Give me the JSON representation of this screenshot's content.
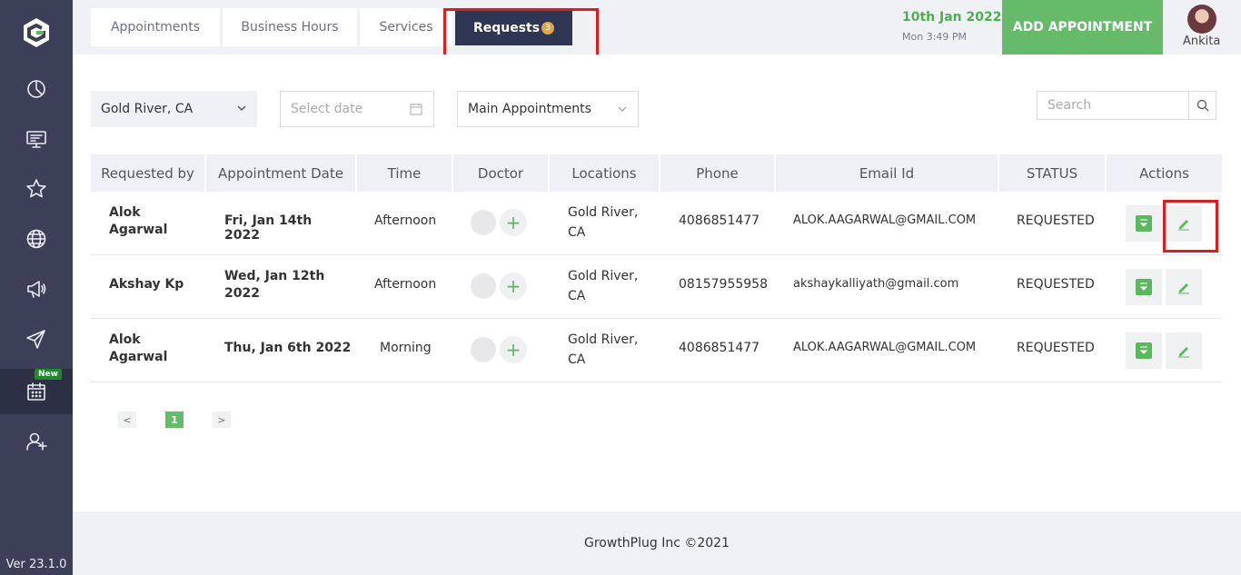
{
  "sidebar": {
    "items": [
      {
        "icon": "dashboard-icon"
      },
      {
        "icon": "monitor-icon"
      },
      {
        "icon": "star-icon"
      },
      {
        "icon": "globe-icon"
      },
      {
        "icon": "megaphone-icon"
      },
      {
        "icon": "send-icon"
      },
      {
        "icon": "calendar-icon",
        "badge": "New"
      },
      {
        "icon": "add-user-icon"
      }
    ],
    "version": "Ver 23.1.0"
  },
  "tabs": {
    "appointments": "Appointments",
    "business_hours": "Business Hours",
    "services": "Services",
    "requests": "Requests",
    "requests_count": "3"
  },
  "header": {
    "date": "10th Jan 2022",
    "time": "Mon 3:49 PM",
    "add_button": "ADD APPOINTMENT",
    "user": "Ankita"
  },
  "filters": {
    "location": "Gold River, CA",
    "date_placeholder": "Select date",
    "type": "Main Appointments",
    "search_placeholder": "Search"
  },
  "table": {
    "headers": [
      "Requested by",
      "Appointment Date",
      "Time",
      "Doctor",
      "Locations",
      "Phone",
      "Email Id",
      "STATUS",
      "Actions"
    ],
    "rows": [
      {
        "name": "Alok Agarwal",
        "date": "Fri, Jan 14th 2022",
        "time": "Afternoon",
        "location": "Gold River, CA",
        "phone": "4086851477",
        "email": "ALOK.AAGARWAL@GMAIL.COM",
        "status": "REQUESTED"
      },
      {
        "name": "Akshay Kp",
        "date": "Wed, Jan 12th 2022",
        "time": "Afternoon",
        "location": "Gold River, CA",
        "phone": "08157955958",
        "email": "akshaykalliyath@gmail.com",
        "status": "REQUESTED"
      },
      {
        "name": "Alok Agarwal",
        "date": "Thu, Jan 6th 2022",
        "time": "Morning",
        "location": "Gold River, CA",
        "phone": "4086851477",
        "email": "ALOK.AAGARWAL@GMAIL.COM",
        "status": "REQUESTED"
      }
    ]
  },
  "pagination": {
    "prev": "<",
    "page": "1",
    "next": ">"
  },
  "footer": "GrowthPlug Inc ©2021",
  "colors": {
    "accent": "#66bb6a",
    "sidebar": "#3b4058",
    "highlight": "#e21a1a"
  }
}
